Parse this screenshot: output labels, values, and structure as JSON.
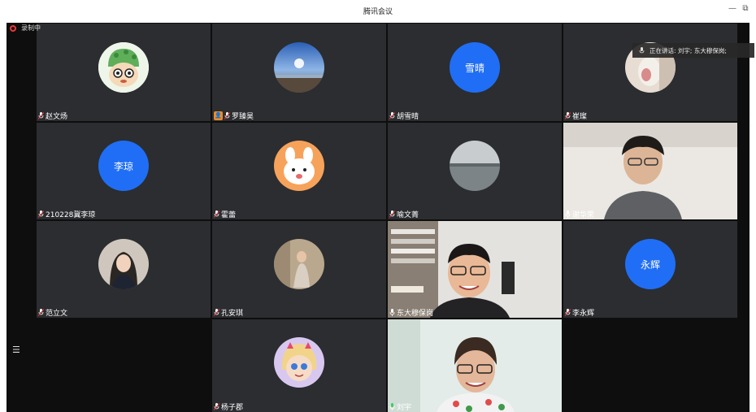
{
  "window": {
    "title": "腾讯会议",
    "minimize": "—",
    "restore": "⧉"
  },
  "recording": {
    "label": "录制中"
  },
  "speaking": {
    "label": "正在讲话: 刘宇; 东大穆保岗;"
  },
  "participants": [
    {
      "name": "赵文炀",
      "avatar": "cartoon-dino-avatar"
    },
    {
      "name": "罗臻昊",
      "avatar": "sky-photo-avatar",
      "badge": "host-badge"
    },
    {
      "name": "胡雪晴",
      "avatar_text": "雪晴"
    },
    {
      "name": "崔璨",
      "avatar": "photo-avatar"
    },
    {
      "name": "210228冀李琼",
      "avatar_text": "李琼"
    },
    {
      "name": "霍蕾",
      "avatar": "cartoon-bunny-avatar"
    },
    {
      "name": "喻文菁",
      "avatar": "lake-photo-avatar"
    },
    {
      "name": "谢华荣",
      "video": true
    },
    {
      "name": "范立文",
      "avatar": "photo-avatar"
    },
    {
      "name": "孔安琪",
      "avatar": "photo-avatar"
    },
    {
      "name": "东大穆保岗",
      "video": true
    },
    {
      "name": "李永辉",
      "avatar_text": "永辉"
    },
    {
      "name": "杨子郡",
      "avatar": "cartoon-star-avatar"
    },
    {
      "name": "刘宇",
      "video": true
    }
  ],
  "colors": {
    "tile_bg": "#2b2d30",
    "stage_bg": "#0e0e0e",
    "letter_avatar": "#1f6ef5",
    "host_badge": "#f08a24",
    "rec_dot": "#e23b3b"
  }
}
